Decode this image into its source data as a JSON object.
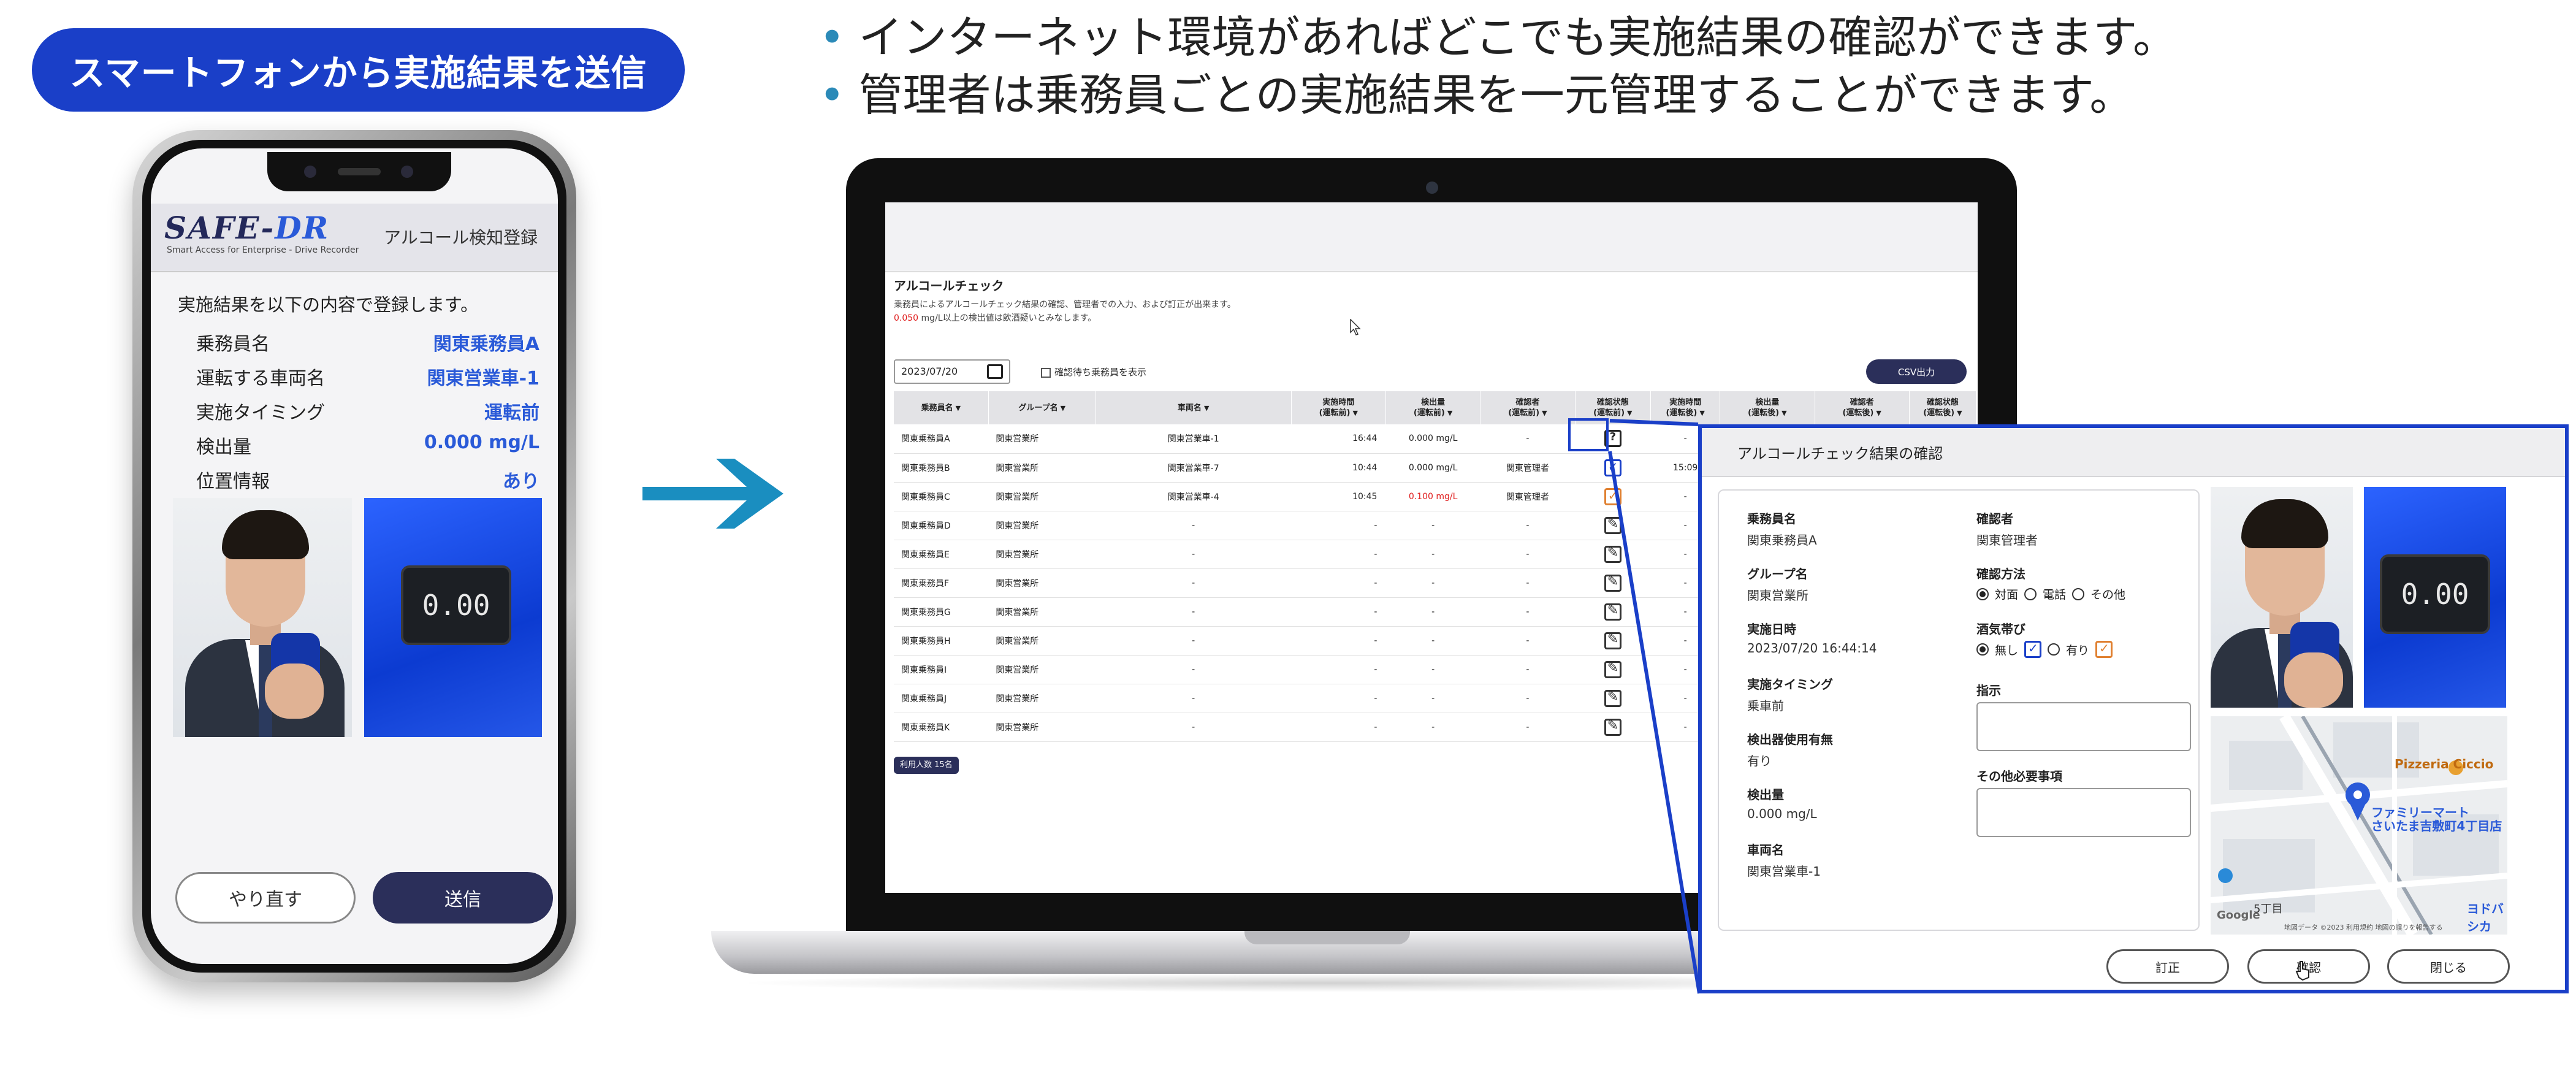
{
  "left_banner": "スマートフォンから実施結果を送信",
  "bullets": [
    "インターネット環境があればどこでも実施結果の確認ができます。",
    "管理者は乗務員ごとの実施結果を一元管理することができます。"
  ],
  "phone": {
    "logo_main": "SAFE-",
    "logo_accent": "DR",
    "logo_sub": "Smart Access for Enterprise - Drive Recorder",
    "header_title": "アルコール検知登録",
    "intro": "実施結果を以下の内容で登録します。",
    "rows": [
      {
        "key": "乗務員名",
        "value": "関東乗務員A"
      },
      {
        "key": "運転する車両名",
        "value": "関東営業車-1"
      },
      {
        "key": "実施タイミング",
        "value": "運転前"
      },
      {
        "key": "検出量",
        "value": "0.000 mg/L"
      },
      {
        "key": "位置情報",
        "value": "あり"
      }
    ],
    "device_reading": "0.00",
    "redo_label": "やり直す",
    "send_label": "送信"
  },
  "app": {
    "title": "アルコールチェック",
    "desc1": "乗務員によるアルコールチェック結果の確認、管理者での入力、および訂正が出来ます。",
    "desc2_red": "0.050",
    "desc2_rest": " mg/L以上の検出値は飲酒疑いとみなします。",
    "date": "2023/07/20",
    "checkbox_label": "確認待ち乗務員を表示",
    "csv_label": "CSV出力",
    "headers": [
      "乗務員名",
      "グループ名",
      "車両名",
      "実施時間\n(運転前)",
      "検出量\n(運転前)",
      "確認者\n(運転前)",
      "確認状態\n(運転前)",
      "実施時間\n(運転後)",
      "検出量\n(運転後)",
      "確認者\n(運転後)",
      "確認状態\n(運転後)"
    ],
    "rows": [
      {
        "name": "関東乗務員A",
        "group": "関東営業所",
        "vehicle": "関東営業車-1",
        "time": "16:44",
        "amount": "0.000 mg/L",
        "amount_red": false,
        "checker": "-",
        "status": "q",
        "time2": "-"
      },
      {
        "name": "関東乗務員B",
        "group": "関東営業所",
        "vehicle": "関東営業車-7",
        "time": "10:44",
        "amount": "0.000 mg/L",
        "amount_red": false,
        "checker": "関東管理者",
        "status": "ok",
        "time2": "15:09"
      },
      {
        "name": "関東乗務員C",
        "group": "関東営業所",
        "vehicle": "関東営業車-4",
        "time": "10:45",
        "amount": "0.100 mg/L",
        "amount_red": true,
        "checker": "関東管理者",
        "status": "ok2",
        "time2": "-"
      },
      {
        "name": "関東乗務員D",
        "group": "関東営業所",
        "vehicle": "-",
        "time": "-",
        "amount": "-",
        "amount_red": false,
        "checker": "-",
        "status": "ed",
        "time2": "-"
      },
      {
        "name": "関東乗務員E",
        "group": "関東営業所",
        "vehicle": "-",
        "time": "-",
        "amount": "-",
        "amount_red": false,
        "checker": "-",
        "status": "ed",
        "time2": "-"
      },
      {
        "name": "関東乗務員F",
        "group": "関東営業所",
        "vehicle": "-",
        "time": "-",
        "amount": "-",
        "amount_red": false,
        "checker": "-",
        "status": "ed",
        "time2": "-"
      },
      {
        "name": "関東乗務員G",
        "group": "関東営業所",
        "vehicle": "-",
        "time": "-",
        "amount": "-",
        "amount_red": false,
        "checker": "-",
        "status": "ed",
        "time2": "-"
      },
      {
        "name": "関東乗務員H",
        "group": "関東営業所",
        "vehicle": "-",
        "time": "-",
        "amount": "-",
        "amount_red": false,
        "checker": "-",
        "status": "ed",
        "time2": "-"
      },
      {
        "name": "関東乗務員I",
        "group": "関東営業所",
        "vehicle": "-",
        "time": "-",
        "amount": "-",
        "amount_red": false,
        "checker": "-",
        "status": "ed",
        "time2": "-"
      },
      {
        "name": "関東乗務員J",
        "group": "関東営業所",
        "vehicle": "-",
        "time": "-",
        "amount": "-",
        "amount_red": false,
        "checker": "-",
        "status": "ed",
        "time2": "-"
      },
      {
        "name": "関東乗務員K",
        "group": "関東営業所",
        "vehicle": "-",
        "time": "-",
        "amount": "-",
        "amount_red": false,
        "checker": "-",
        "status": "ed",
        "time2": "-"
      }
    ],
    "user_count": "利用人数 15名"
  },
  "dialog": {
    "title": "アルコールチェック結果の確認",
    "left_fields": [
      {
        "label": "乗務員名",
        "value": "関東乗務員A"
      },
      {
        "label": "グループ名",
        "value": "関東営業所"
      },
      {
        "label": "実施日時",
        "value": "2023/07/20 16:44:14"
      },
      {
        "label": "実施タイミング",
        "value": "乗車前"
      },
      {
        "label": "検出器使用有無",
        "value": "有り"
      },
      {
        "label": "検出量",
        "value": "0.000 mg/L"
      },
      {
        "label": "車両名",
        "value": "関東営業車-1"
      }
    ],
    "checker_label": "確認者",
    "checker_value": "関東管理者",
    "method_label": "確認方法",
    "method_options": [
      "対面",
      "電話",
      "その他"
    ],
    "drunk_label": "酒気帯び",
    "drunk_options": [
      "無し",
      "有り"
    ],
    "instruction_label": "指示",
    "other_label": "その他必要事項",
    "buttons": {
      "correct": "訂正",
      "confirm": "確認",
      "close": "閉じる"
    },
    "device_reading": "0.00",
    "map_labels": {
      "shop": "Pizzeria Ciccio",
      "station": "ファミリーマート\nさいたま吉敷町4丁目店",
      "area": "ヨドバシカ",
      "block": "5丁目",
      "footer": "地図データ ©2023 利用規約 地図の誤りを報告する",
      "google": "Google"
    }
  },
  "colors": {
    "accent_blue": "#1a3fc8",
    "navy": "#2b2f5a",
    "teal_arrow": "#1a8ec0",
    "red": "#e02020",
    "orange": "#e08030"
  }
}
